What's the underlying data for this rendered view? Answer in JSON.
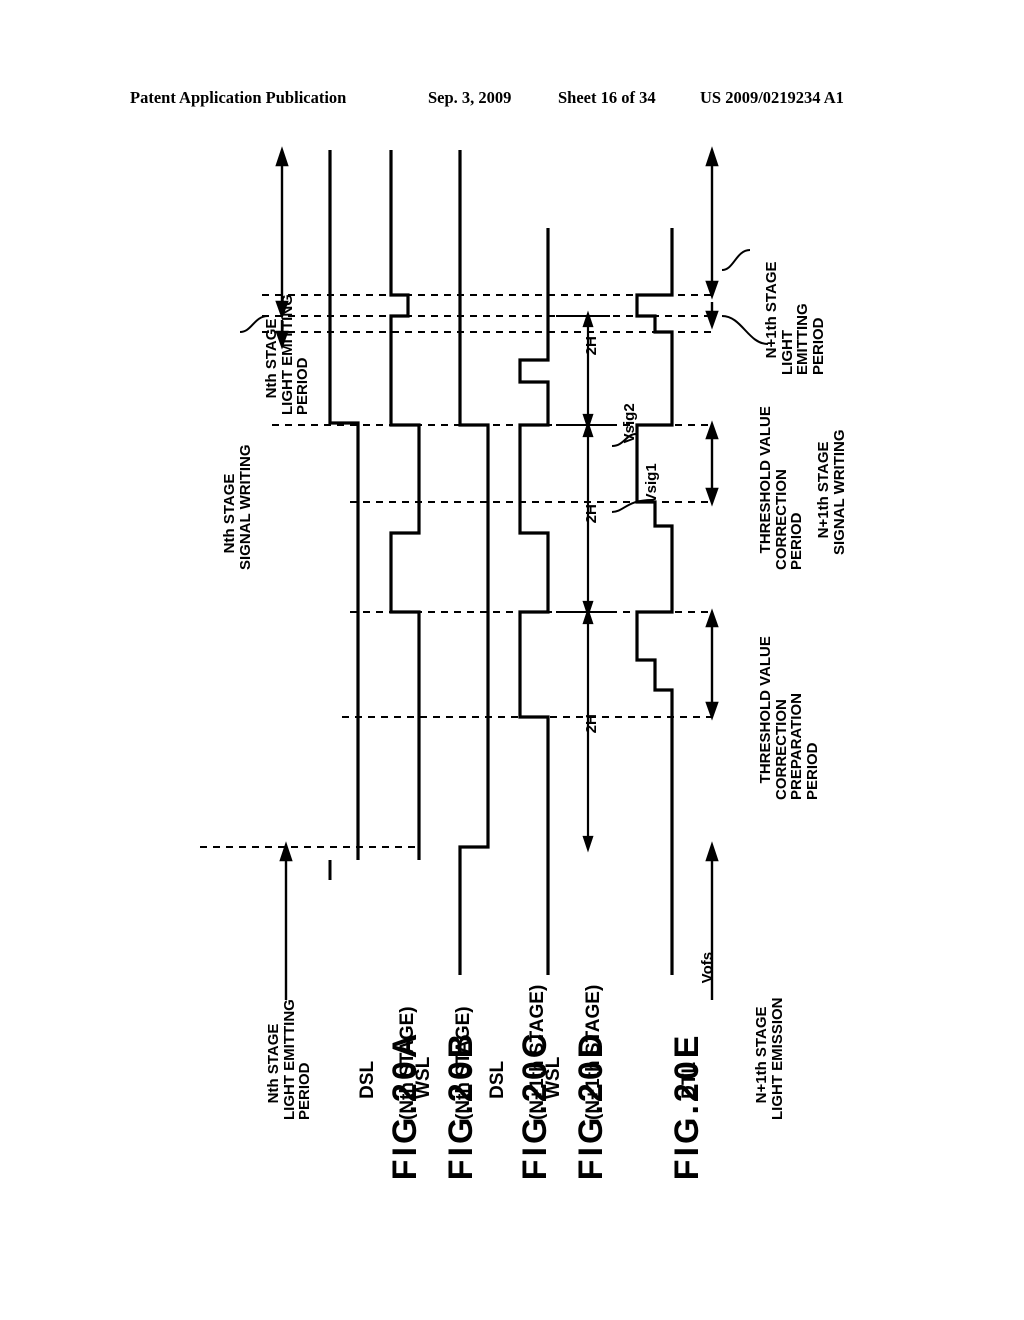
{
  "header": {
    "publication": "Patent Application Publication",
    "date": "Sep. 3, 2009",
    "sheet": "Sheet 16 of 34",
    "patent_number": "US 2009/0219234 A1"
  },
  "figure": {
    "labels": [
      {
        "id": "fig20a",
        "text": "FIG.20A"
      },
      {
        "id": "fig20b",
        "text": "FIG.20B"
      },
      {
        "id": "fig20c",
        "text": "FIG.20C"
      },
      {
        "id": "fig20d",
        "text": "FIG.20D"
      },
      {
        "id": "fig20e",
        "text": "FIG.20E"
      }
    ],
    "signals": [
      {
        "id": "dsl_nth",
        "line1": "DSL",
        "line2": "(Nth STAGE)"
      },
      {
        "id": "wsl_nth",
        "line1": "WSL",
        "line2": "(Nth STAGE)"
      },
      {
        "id": "dsl_np1",
        "line1": "DSL",
        "line2": "(N+1th STAGE)"
      },
      {
        "id": "wsl_np1",
        "line1": "WSL",
        "line2": "(N+1th STAGE)"
      },
      {
        "id": "dtl",
        "line1": "DTL",
        "line2": ""
      }
    ],
    "annotations": {
      "nth_signal_writing": "Nth STAGE\nSIGNAL WRITING",
      "nth_light_emitting_period_top": "Nth STAGE\nLIGHT EMITTING\nPERIOD",
      "nth_light_emitting_period_bottom": "Nth STAGE\nLIGHT EMITTING\nPERIOD",
      "np1_light_emitting_period": "N+1th STAGE\nLIGHT\nEMITTING\nPERIOD",
      "np1_signal_writing": "N+1th STAGE\nSIGNAL WRITING",
      "threshold_correction_period": "THRESHOLD VALUE\nCORRECTION\nPERIOD",
      "threshold_correction_preparation_period": "THRESHOLD VALUE\nCORRECTION\nPREPARATION\nPERIOD",
      "np1_light_emission": "N+1th STAGE\nLIGHT EMISSION"
    },
    "waveform_labels": {
      "vsig2": "Vsig2",
      "vsig1": "Vsig1",
      "vofs": "Vofs",
      "period_2h": "2H"
    },
    "period_markers": [
      {
        "id": "2h-top",
        "text": "2H"
      },
      {
        "id": "2h-mid",
        "text": "2H"
      },
      {
        "id": "2h-bottom",
        "text": "2H"
      }
    ],
    "colors": {
      "ink": "#000000",
      "paper": "#ffffff"
    }
  }
}
